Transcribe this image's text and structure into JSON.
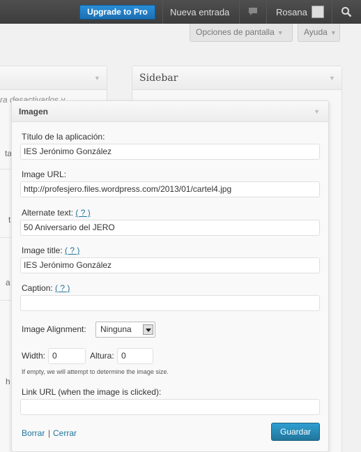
{
  "adminbar": {
    "upgrade_label": "Upgrade to Pro",
    "new_entry": "Nueva entrada",
    "user_name": "Rosana"
  },
  "screen_tabs": {
    "options_label": "Opciones de pantalla",
    "help_label": "Ayuda"
  },
  "background": {
    "sidebar_title": "Sidebar",
    "fragment_deactivate": "ra desactivarlos y",
    "fragment_letters": [
      "ta",
      "t",
      "a",
      "h"
    ]
  },
  "widget": {
    "title": "Imagen",
    "app_title_label": "Título de la aplicación:",
    "app_title_value": "IES Jerónimo González",
    "image_url_label": "Image URL:",
    "image_url_value": "http://profesjero.files.wordpress.com/2013/01/cartel4.jpg",
    "alt_text_label": "Alternate text:",
    "alt_text_value": "50 Aniversario del JERO",
    "image_title_label": "Image title:",
    "image_title_value": "IES Jerónimo González",
    "caption_label": "Caption:",
    "caption_value": "",
    "help_link": "( ? )",
    "alignment_label": "Image Alignment:",
    "alignment_value": "Ninguna",
    "width_label": "Width:",
    "width_value": "0",
    "height_label": "Altura:",
    "height_value": "0",
    "size_note": "If empty, we will attempt to determine the image size.",
    "link_url_label": "Link URL (when the image is clicked):",
    "link_url_value": "",
    "delete_link": "Borrar",
    "separator": "|",
    "close_link": "Cerrar",
    "save_button": "Guardar"
  }
}
